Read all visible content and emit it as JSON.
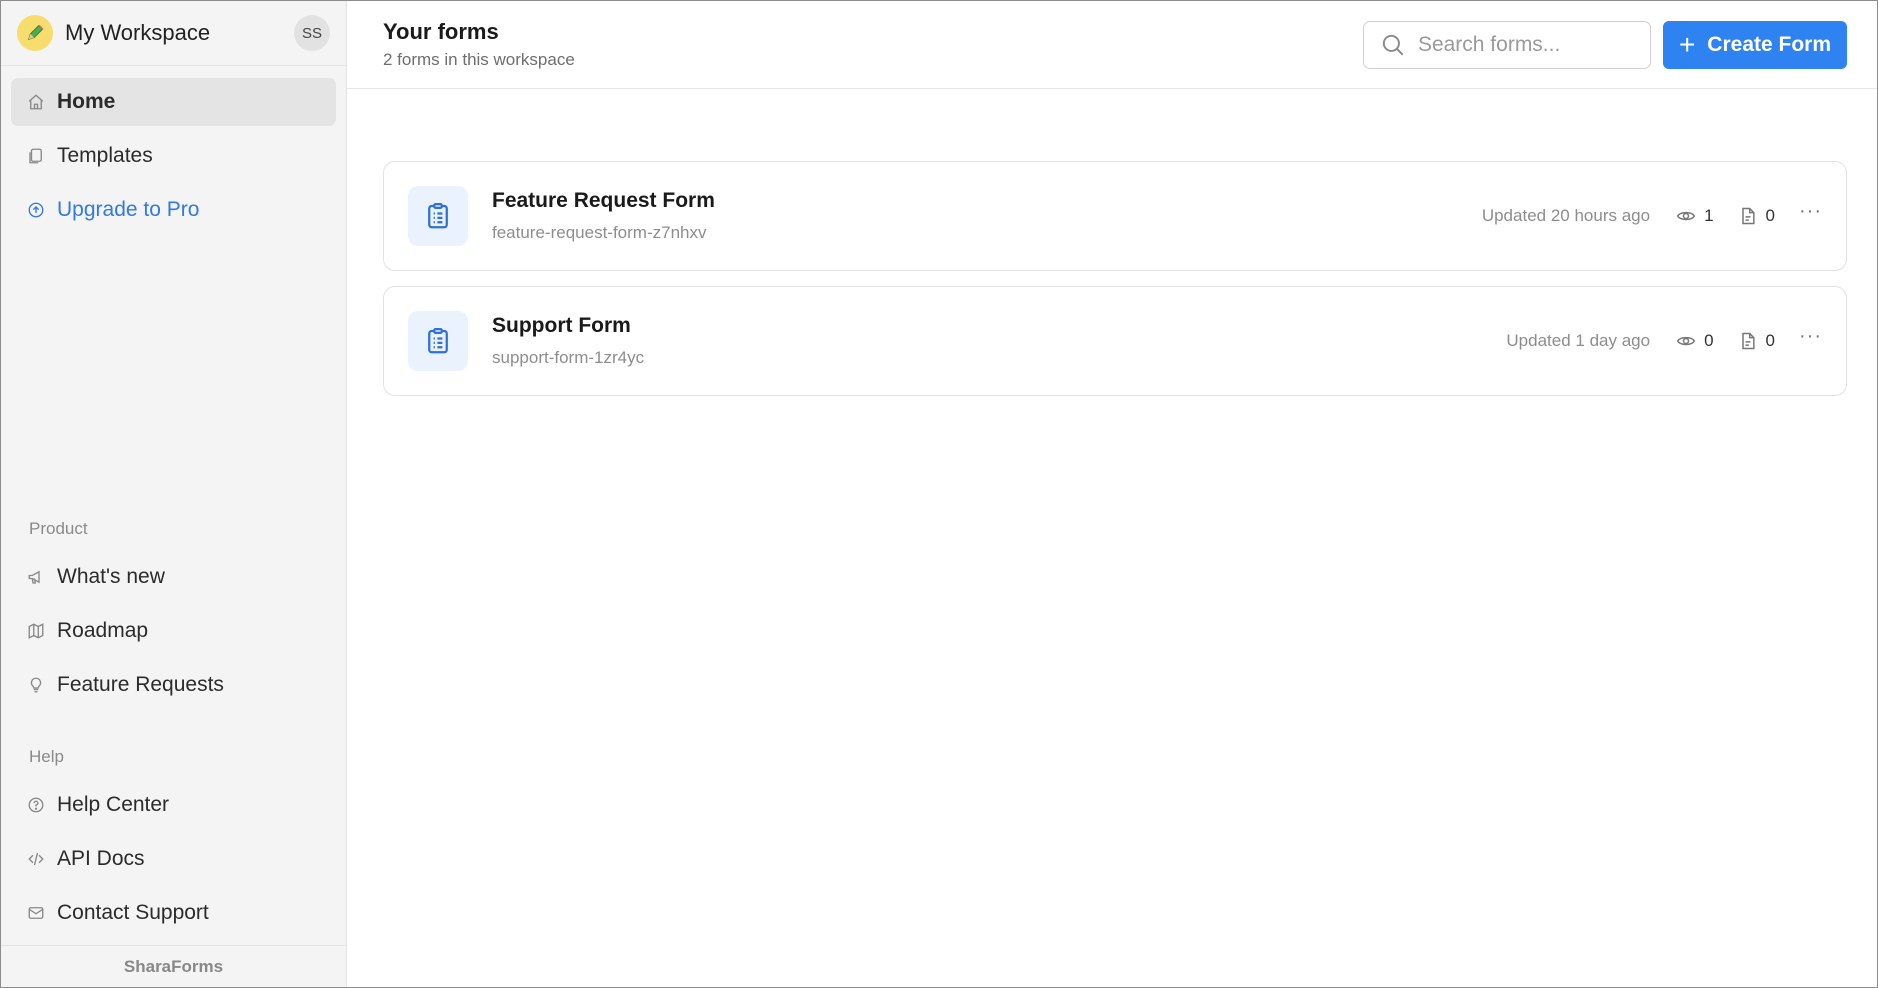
{
  "workspace": {
    "name": "My Workspace",
    "avatar": "SS",
    "logo_icon": "pencil-icon",
    "logo_color": "#f7dd6e"
  },
  "nav": {
    "main": [
      {
        "label": "Home",
        "icon": "home-icon",
        "active": true
      },
      {
        "label": "Templates",
        "icon": "templates-icon"
      },
      {
        "label": "Upgrade to Pro",
        "icon": "upgrade-icon",
        "color": "#2f7ae5"
      }
    ],
    "product_label": "Product",
    "product": [
      {
        "label": "What's new",
        "icon": "megaphone-icon"
      },
      {
        "label": "Roadmap",
        "icon": "map-icon"
      },
      {
        "label": "Feature Requests",
        "icon": "lightbulb-icon"
      }
    ],
    "help_label": "Help",
    "help": [
      {
        "label": "Help Center",
        "icon": "question-icon"
      },
      {
        "label": "API Docs",
        "icon": "code-icon"
      },
      {
        "label": "Contact Support",
        "icon": "mail-icon"
      }
    ]
  },
  "footer": {
    "brand": "SharaForms"
  },
  "header": {
    "title": "Your forms",
    "subtitle": "2 forms in this workspace",
    "search_placeholder": "Search forms...",
    "create_label": "Create Form",
    "accent_color": "#2f83f0"
  },
  "forms": [
    {
      "name": "Feature Request Form",
      "slug": "feature-request-form-z7nhxv",
      "updated": "Updated 20 hours ago",
      "views": "1",
      "responses": "0"
    },
    {
      "name": "Support Form",
      "slug": "support-form-1zr4yc",
      "updated": "Updated 1 day ago",
      "views": "0",
      "responses": "0"
    }
  ]
}
